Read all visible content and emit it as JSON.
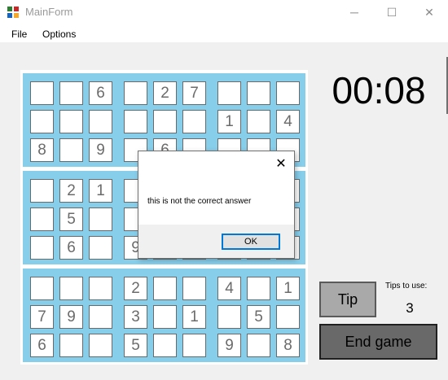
{
  "window": {
    "title": "MainForm",
    "minimize_glyph": "─",
    "maximize_glyph": "☐",
    "close_glyph": "✕"
  },
  "menu": {
    "items": [
      "File",
      "Options"
    ]
  },
  "board": {
    "rows": [
      [
        "",
        "",
        "6",
        "",
        "2",
        "7",
        "",
        "",
        ""
      ],
      [
        "",
        "",
        "",
        "",
        "",
        "",
        "1",
        "",
        "4"
      ],
      [
        "8",
        "",
        "9",
        "",
        "6",
        "",
        "",
        "",
        ""
      ],
      [
        "",
        "2",
        "1",
        "",
        "",
        "",
        "",
        "",
        ""
      ],
      [
        "",
        "5",
        "",
        "",
        "",
        "",
        "",
        "",
        ""
      ],
      [
        "",
        "6",
        "",
        "9",
        "",
        "",
        "",
        "",
        ""
      ],
      [
        "",
        "",
        "",
        "2",
        "",
        "",
        "4",
        "",
        "1"
      ],
      [
        "7",
        "9",
        "",
        "3",
        "",
        "1",
        "",
        "5",
        ""
      ],
      [
        "6",
        "",
        "",
        "5",
        "",
        "",
        "9",
        "",
        "8"
      ]
    ]
  },
  "timer": "00:08",
  "tip_button": "Tip",
  "tips_label": "Tips to use:",
  "tips_count": "3",
  "end_button": "End game",
  "dialog": {
    "message": "this is not the correct answer",
    "ok_label": "OK",
    "close_glyph": "✕"
  },
  "colors": {
    "block": "#87ceeb",
    "tip_button": "#a9a9a9",
    "end_button": "#696969",
    "ok_border": "#0078d7"
  }
}
